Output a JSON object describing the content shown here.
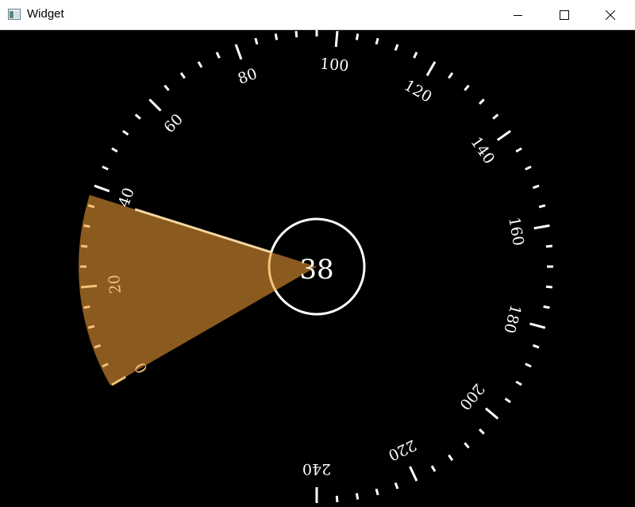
{
  "window": {
    "title": "Widget",
    "icons": {
      "app": "app-window-icon",
      "minimize": "minimize-icon",
      "maximize": "maximize-icon",
      "close": "close-icon"
    }
  },
  "gauge": {
    "min": 0,
    "max": 240,
    "major_step": 20,
    "minor_step": 4,
    "value": 38,
    "value_label": "38",
    "labels": [
      "0",
      "20",
      "40",
      "60",
      "80",
      "100",
      "120",
      "140",
      "160",
      "180",
      "200",
      "220",
      "240"
    ],
    "colors": {
      "background": "#000000",
      "fill": "#8b5a1f",
      "active_ticks": "#f5c27a",
      "inactive_ticks": "#ffffff",
      "ring_active": "#f5c27a",
      "ring_inactive": "#ffffff",
      "pointer": "#f5d5a0"
    }
  }
}
